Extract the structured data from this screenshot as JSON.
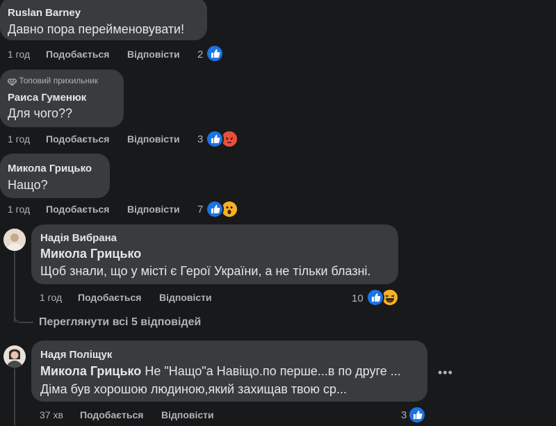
{
  "labels": {
    "like": "Подобається",
    "reply": "Відповісти"
  },
  "comments": [
    {
      "author": "Ruslan Barney",
      "text": "Давно пора перейменовувати!",
      "time": "1 год",
      "reactions": "2"
    },
    {
      "badge": "Топовий прихильник",
      "author": "Раиса Гуменюк",
      "text": "Для чого??",
      "time": "1 год",
      "reactions": "3"
    },
    {
      "author": "Микола Грицько",
      "text": "Нащо?",
      "time": "1 год",
      "reactions": "7"
    }
  ],
  "replies": [
    {
      "author": "Надія Вибрана",
      "mention": "Микола Грицько",
      "text": "Щоб знали, що у місті є Герої України, а не тільки блазні.",
      "time": "1 год",
      "reactions": "10"
    },
    {
      "author": "Надя Поліщук",
      "mention": "Микола Грицько",
      "text_line1": "Не \"Нащо\"а Навіщо.по перше...в по друге ...",
      "text_line2": "Діма був хорошою людиною,який захищав твою ср...",
      "time": "37 хв",
      "reactions": "3"
    }
  ],
  "view_replies": "Переглянути всі 5 відповідей",
  "colors": {
    "background": "#18191a",
    "bubble": "#3a3b3c",
    "like_blue": "#1b74e4",
    "secondary_text": "#b0b3b8"
  }
}
